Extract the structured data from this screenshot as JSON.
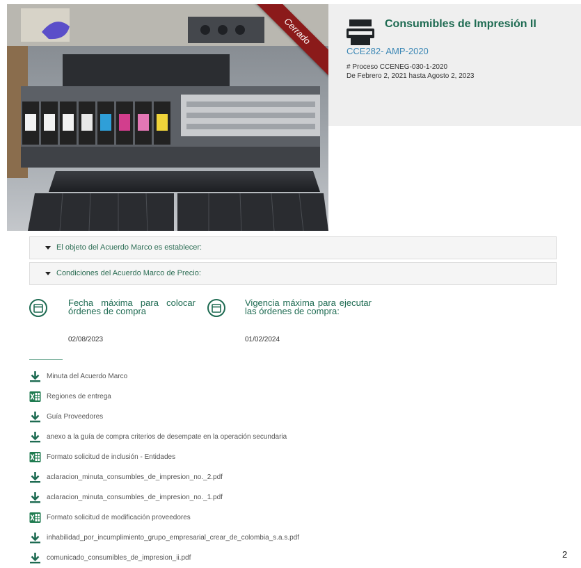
{
  "hero": {
    "status_ribbon": "Cerrado"
  },
  "info": {
    "icon": "printer-icon",
    "title": "Consumibles de Impresión II",
    "code": "CCE282- AMP-2020",
    "process": "# Proceso CCENEG-030-1-2020",
    "dates_range": "De Febrero 2, 2021 hasta Agosto 2, 2023"
  },
  "accordions": [
    {
      "label": "El objeto del Acuerdo Marco es establecer:"
    },
    {
      "label": "Condiciones del Acuerdo Marco de Precio:"
    }
  ],
  "dates": [
    {
      "icon": "calendar-icon",
      "label": "Fecha máxima para colocar órdenes de compra",
      "value": "02/08/2023"
    },
    {
      "icon": "calendar-icon",
      "label": "Vigencia máxima para ejecutar las órdenes de compra:",
      "value": "01/02/2024"
    }
  ],
  "documents": [
    {
      "icon": "download-icon",
      "label": "Minuta del Acuerdo Marco"
    },
    {
      "icon": "excel-icon",
      "label": "Regiones de entrega"
    },
    {
      "icon": "download-icon",
      "label": "Guía Proveedores"
    },
    {
      "icon": "download-icon",
      "label": "anexo a la guía de compra criterios de desempate en la operación secundaria"
    },
    {
      "icon": "excel-icon",
      "label": "Formato solicitud de inclusión - Entidades"
    },
    {
      "icon": "download-icon",
      "label": "aclaracion_minuta_consumbles_de_impresion_no._2.pdf"
    },
    {
      "icon": "download-icon",
      "label": "aclaracion_minuta_consumbles_de_impresion_no._1.pdf"
    },
    {
      "icon": "excel-icon",
      "label": "Formato solicitud de modificación proveedores"
    },
    {
      "icon": "download-icon",
      "label": "inhabilidad_por_incumplimiento_grupo_empresarial_crear_de_colombia_s.a.s.pdf"
    },
    {
      "icon": "download-icon",
      "label": "comunicado_consumibles_de_impresion_ii.pdf"
    }
  ],
  "page_number": "2",
  "colors": {
    "brand_green": "#1e6b52",
    "link_blue": "#3b87b5",
    "ribbon_red": "#8b1a1a"
  }
}
